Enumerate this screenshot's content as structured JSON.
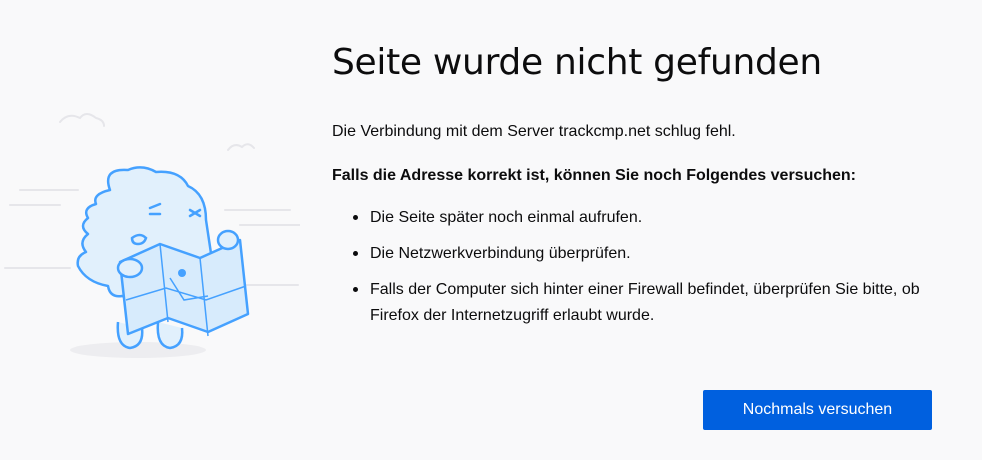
{
  "error": {
    "title": "Seite wurde nicht gefunden",
    "description": "Die Verbindung mit dem Server trackcmp.net schlug fehl.",
    "subtitle": "Falls die Adresse korrekt ist, können Sie noch Folgendes versuchen:",
    "suggestions": [
      "Die Seite später noch einmal aufrufen.",
      "Die Netzwerkverbindung überprüfen.",
      "Falls der Computer sich hinter einer Firewall befindet, überprüfen Sie bitte, ob Firefox der Internetzugriff erlaubt wurde."
    ]
  },
  "actions": {
    "retry_label": "Nochmals versuchen"
  },
  "colors": {
    "background": "#f9f9fa",
    "accent": "#0060df",
    "illustration_line": "#45a1ff",
    "illustration_fill": "#e1f0fc"
  },
  "illustration": {
    "icon": "confused-monster-with-map-icon"
  }
}
